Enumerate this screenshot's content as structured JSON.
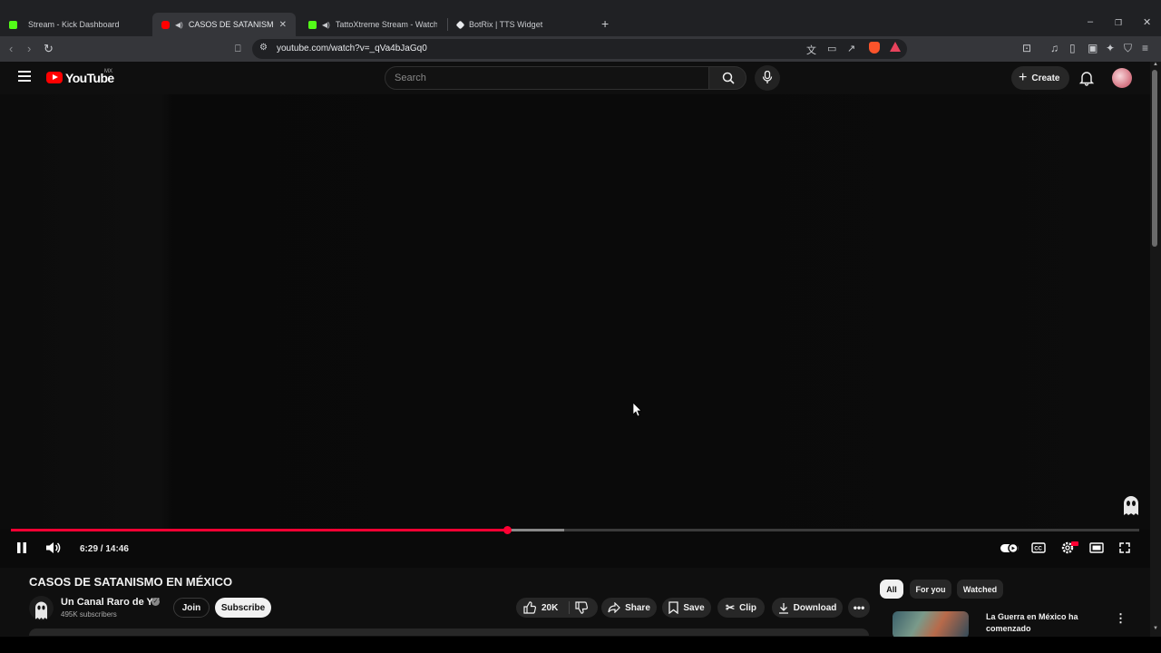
{
  "browser": {
    "tabs": [
      {
        "label": "Stream - Kick Dashboard",
        "favicon": "kick-icon",
        "color": "#53fc18"
      },
      {
        "label": "CASOS DE SATANISMO EN M",
        "favicon": "youtube-icon",
        "color": "#ff0000",
        "active": true
      },
      {
        "label": "TattoXtreme Stream - Watch Live",
        "favicon": "kick-icon",
        "color": "#53fc18"
      },
      {
        "label": "BotRix | TTS Widget",
        "favicon": "botrix-icon",
        "color": "#e8eaed"
      }
    ],
    "new_tab": "+",
    "url": "youtube.com/watch?v=_qVa4bJaGq0"
  },
  "youtube": {
    "logo_text": "YouTube",
    "country_code": "MX",
    "search_placeholder": "Search",
    "create_label": "Create"
  },
  "player": {
    "time_display": "6:29 / 14:46",
    "progress_fraction": 0.44,
    "buffered_fraction": 0.49,
    "accent_color": "#ff0033"
  },
  "video": {
    "title": "CASOS DE SATANISMO EN MÉXICO",
    "channel": "Un Canal Raro de YT",
    "subscribers": "495K subscribers",
    "join_label": "Join",
    "subscribe_label": "Subscribe",
    "likes": "20K",
    "share_label": "Share",
    "save_label": "Save",
    "clip_label": "Clip",
    "download_label": "Download"
  },
  "sidebar": {
    "chips": [
      "All",
      "For you",
      "Watched"
    ],
    "recommendation_title": "La Guerra en México ha comenzado"
  }
}
